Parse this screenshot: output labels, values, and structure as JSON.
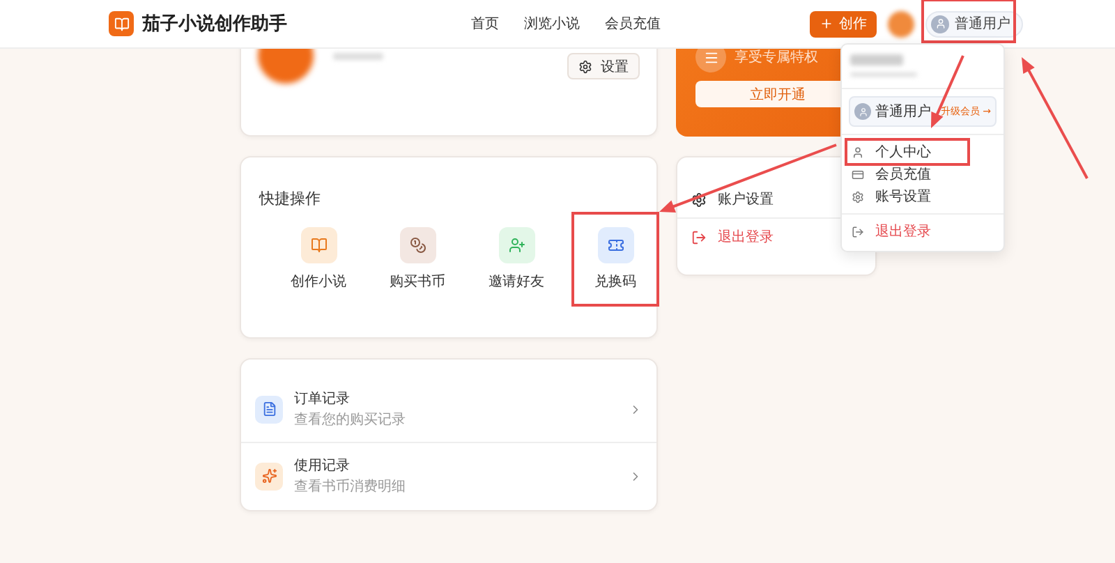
{
  "header": {
    "app_name": "茄子小说创作助手",
    "nav": [
      {
        "label": "首页"
      },
      {
        "label": "浏览小说"
      },
      {
        "label": "会员充值"
      }
    ],
    "create_button": "创作",
    "user_pill": {
      "label": "普通用户",
      "highlighted": true
    }
  },
  "profile_card": {
    "settings_button": "设置"
  },
  "vip_card": {
    "subtitle": "享受专属特权",
    "button": "立即开通"
  },
  "quick_actions": {
    "title": "快捷操作",
    "items": [
      {
        "kind": "book",
        "label": "创作小说",
        "highlighted": false
      },
      {
        "kind": "coins",
        "label": "购买书币",
        "highlighted": false
      },
      {
        "kind": "invite",
        "label": "邀请好友",
        "highlighted": false
      },
      {
        "kind": "ticket",
        "label": "兑换码",
        "highlighted": true
      }
    ]
  },
  "records": [
    {
      "kind": "orders",
      "title": "订单记录",
      "subtitle": "查看您的购买记录"
    },
    {
      "kind": "usage",
      "title": "使用记录",
      "subtitle": "查看书币消费明细"
    }
  ],
  "account_menu": [
    {
      "kind": "settings",
      "label": "账户设置"
    },
    {
      "kind": "logout",
      "label": "退出登录"
    }
  ],
  "dropdown": {
    "level": "普通用户",
    "upgrade_link": "升级会员 →",
    "items": [
      {
        "kind": "user",
        "label": "个人中心",
        "highlighted": true
      },
      {
        "kind": "card",
        "label": "会员充值",
        "highlighted": false
      },
      {
        "kind": "settings",
        "label": "账号设置",
        "highlighted": false
      },
      {
        "kind": "logout",
        "label": "退出登录",
        "highlighted": false
      }
    ]
  }
}
